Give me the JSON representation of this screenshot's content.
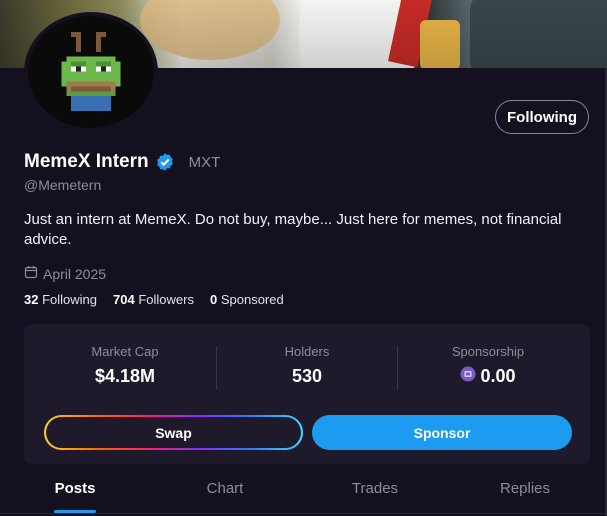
{
  "profile": {
    "display_name": "MemeX Intern",
    "ticker": "MXT",
    "handle": "@Memetern",
    "bio": "Just an intern at MemeX. Do not buy, maybe... Just here for memes, not financial advice.",
    "joined": "April 2025",
    "follow_label": "Following"
  },
  "stats": {
    "following_count": "32",
    "following_label": "Following",
    "followers_count": "704",
    "followers_label": "Followers",
    "sponsored_count": "0",
    "sponsored_label": "Sponsored"
  },
  "metrics": {
    "market_cap_label": "Market Cap",
    "market_cap_value": "$4.18M",
    "holders_label": "Holders",
    "holders_value": "530",
    "sponsorship_label": "Sponsorship",
    "sponsorship_value": "0.00"
  },
  "actions": {
    "swap_label": "Swap",
    "sponsor_label": "Sponsor"
  },
  "tabs": [
    {
      "label": "Posts"
    },
    {
      "label": "Chart"
    },
    {
      "label": "Trades"
    },
    {
      "label": "Replies"
    }
  ],
  "icons": {
    "verified": "verified-badge-icon",
    "calendar": "calendar-icon",
    "sponsorship_token": "token-icon"
  },
  "colors": {
    "accent": "#1d9bf0",
    "background": "#15101f",
    "card": "#1f1a2b",
    "muted_text": "#8f8b99"
  }
}
